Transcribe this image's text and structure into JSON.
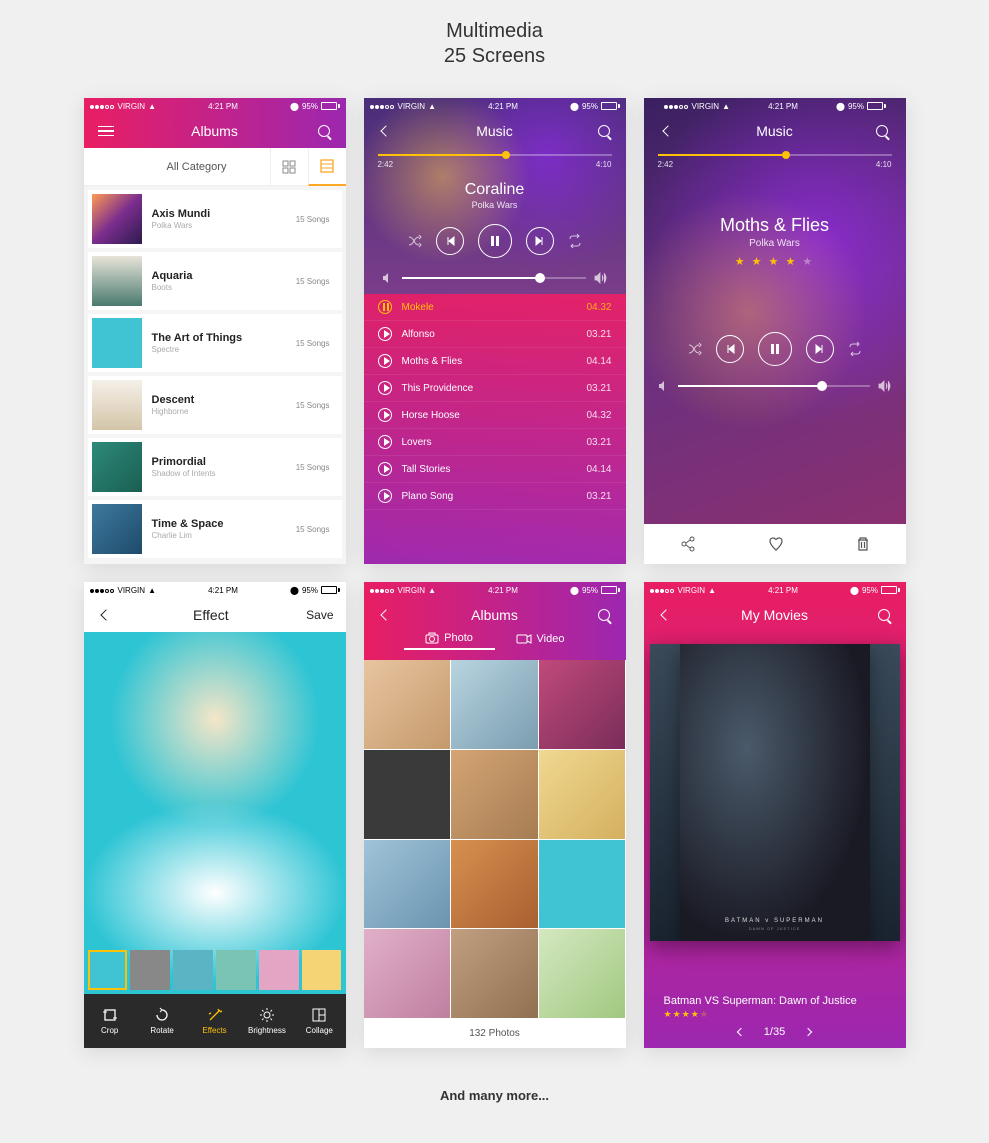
{
  "page": {
    "title": "Multimedia",
    "subtitle": "25 Screens",
    "footer": "And many more..."
  },
  "statusbar": {
    "carrier": "VIRGIN",
    "time": "4:21 PM",
    "battery": "95%"
  },
  "screen1": {
    "title": "Albums",
    "category_label": "All Category",
    "albums": [
      {
        "title": "Axis Mundi",
        "artist": "Polka Wars",
        "count": "15 Songs"
      },
      {
        "title": "Aquaria",
        "artist": "Boots",
        "count": "15 Songs"
      },
      {
        "title": "The Art of Things",
        "artist": "Spectre",
        "count": "15 Songs"
      },
      {
        "title": "Descent",
        "artist": "Highborne",
        "count": "15 Songs"
      },
      {
        "title": "Primordial",
        "artist": "Shadow of Intents",
        "count": "15 Songs"
      },
      {
        "title": "Time & Space",
        "artist": "Charlie Lim",
        "count": "15 Songs"
      }
    ]
  },
  "screen2": {
    "title": "Music",
    "time_elapsed": "2:42",
    "time_total": "4:10",
    "progress_pct": 55,
    "song": "Coraline",
    "artist": "Polka Wars",
    "tracks": [
      {
        "name": "Mokele",
        "dur": "04.32",
        "active": true
      },
      {
        "name": "Alfonso",
        "dur": "03.21"
      },
      {
        "name": "Moths & Flies",
        "dur": "04.14"
      },
      {
        "name": "This Providence",
        "dur": "03.21"
      },
      {
        "name": "Horse Hoose",
        "dur": "04.32"
      },
      {
        "name": "Lovers",
        "dur": "03.21"
      },
      {
        "name": "Tall Stories",
        "dur": "04.14"
      },
      {
        "name": "Plano Song",
        "dur": "03.21"
      }
    ]
  },
  "screen3": {
    "title": "Music",
    "time_elapsed": "2:42",
    "time_total": "4:10",
    "progress_pct": 55,
    "song": "Moths & Flies",
    "artist": "Polka Wars",
    "rating": 4
  },
  "screen4": {
    "title": "Effect",
    "save": "Save",
    "tools": [
      {
        "label": "Crop"
      },
      {
        "label": "Rotate"
      },
      {
        "label": "Effects",
        "active": true
      },
      {
        "label": "Brightness"
      },
      {
        "label": "Collage"
      }
    ]
  },
  "screen5": {
    "title": "Albums",
    "tab_photo": "Photo",
    "tab_video": "Video",
    "photo_count": "132 Photos"
  },
  "screen6": {
    "title": "My Movies",
    "poster_title": "BATMAN v SUPERMAN",
    "poster_sub": "DAWN OF JUSTICE",
    "movie_title": "Batman VS Superman: Dawn of Justice",
    "rating": 4,
    "pager": "1/35"
  }
}
